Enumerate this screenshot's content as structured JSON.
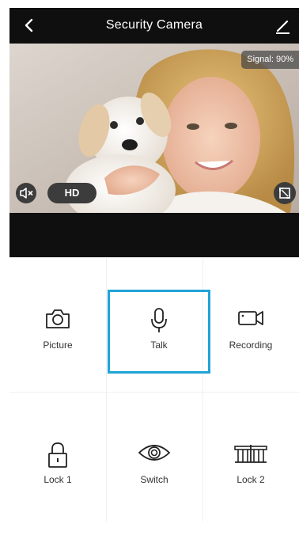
{
  "header": {
    "title": "Security Camera"
  },
  "video": {
    "signal": "Signal: 90%",
    "quality": "HD"
  },
  "controls": [
    {
      "label": "Picture",
      "icon": "camera-icon"
    },
    {
      "label": "Talk",
      "icon": "microphone-icon",
      "selected": true
    },
    {
      "label": "Recording",
      "icon": "video-camera-icon"
    },
    {
      "label": "Lock 1",
      "icon": "padlock-icon"
    },
    {
      "label": "Switch",
      "icon": "eye-icon"
    },
    {
      "label": "Lock 2",
      "icon": "gate-icon"
    }
  ],
  "colors": {
    "header_bg": "#0f0f0f",
    "selected_border": "#1fa4d6"
  }
}
